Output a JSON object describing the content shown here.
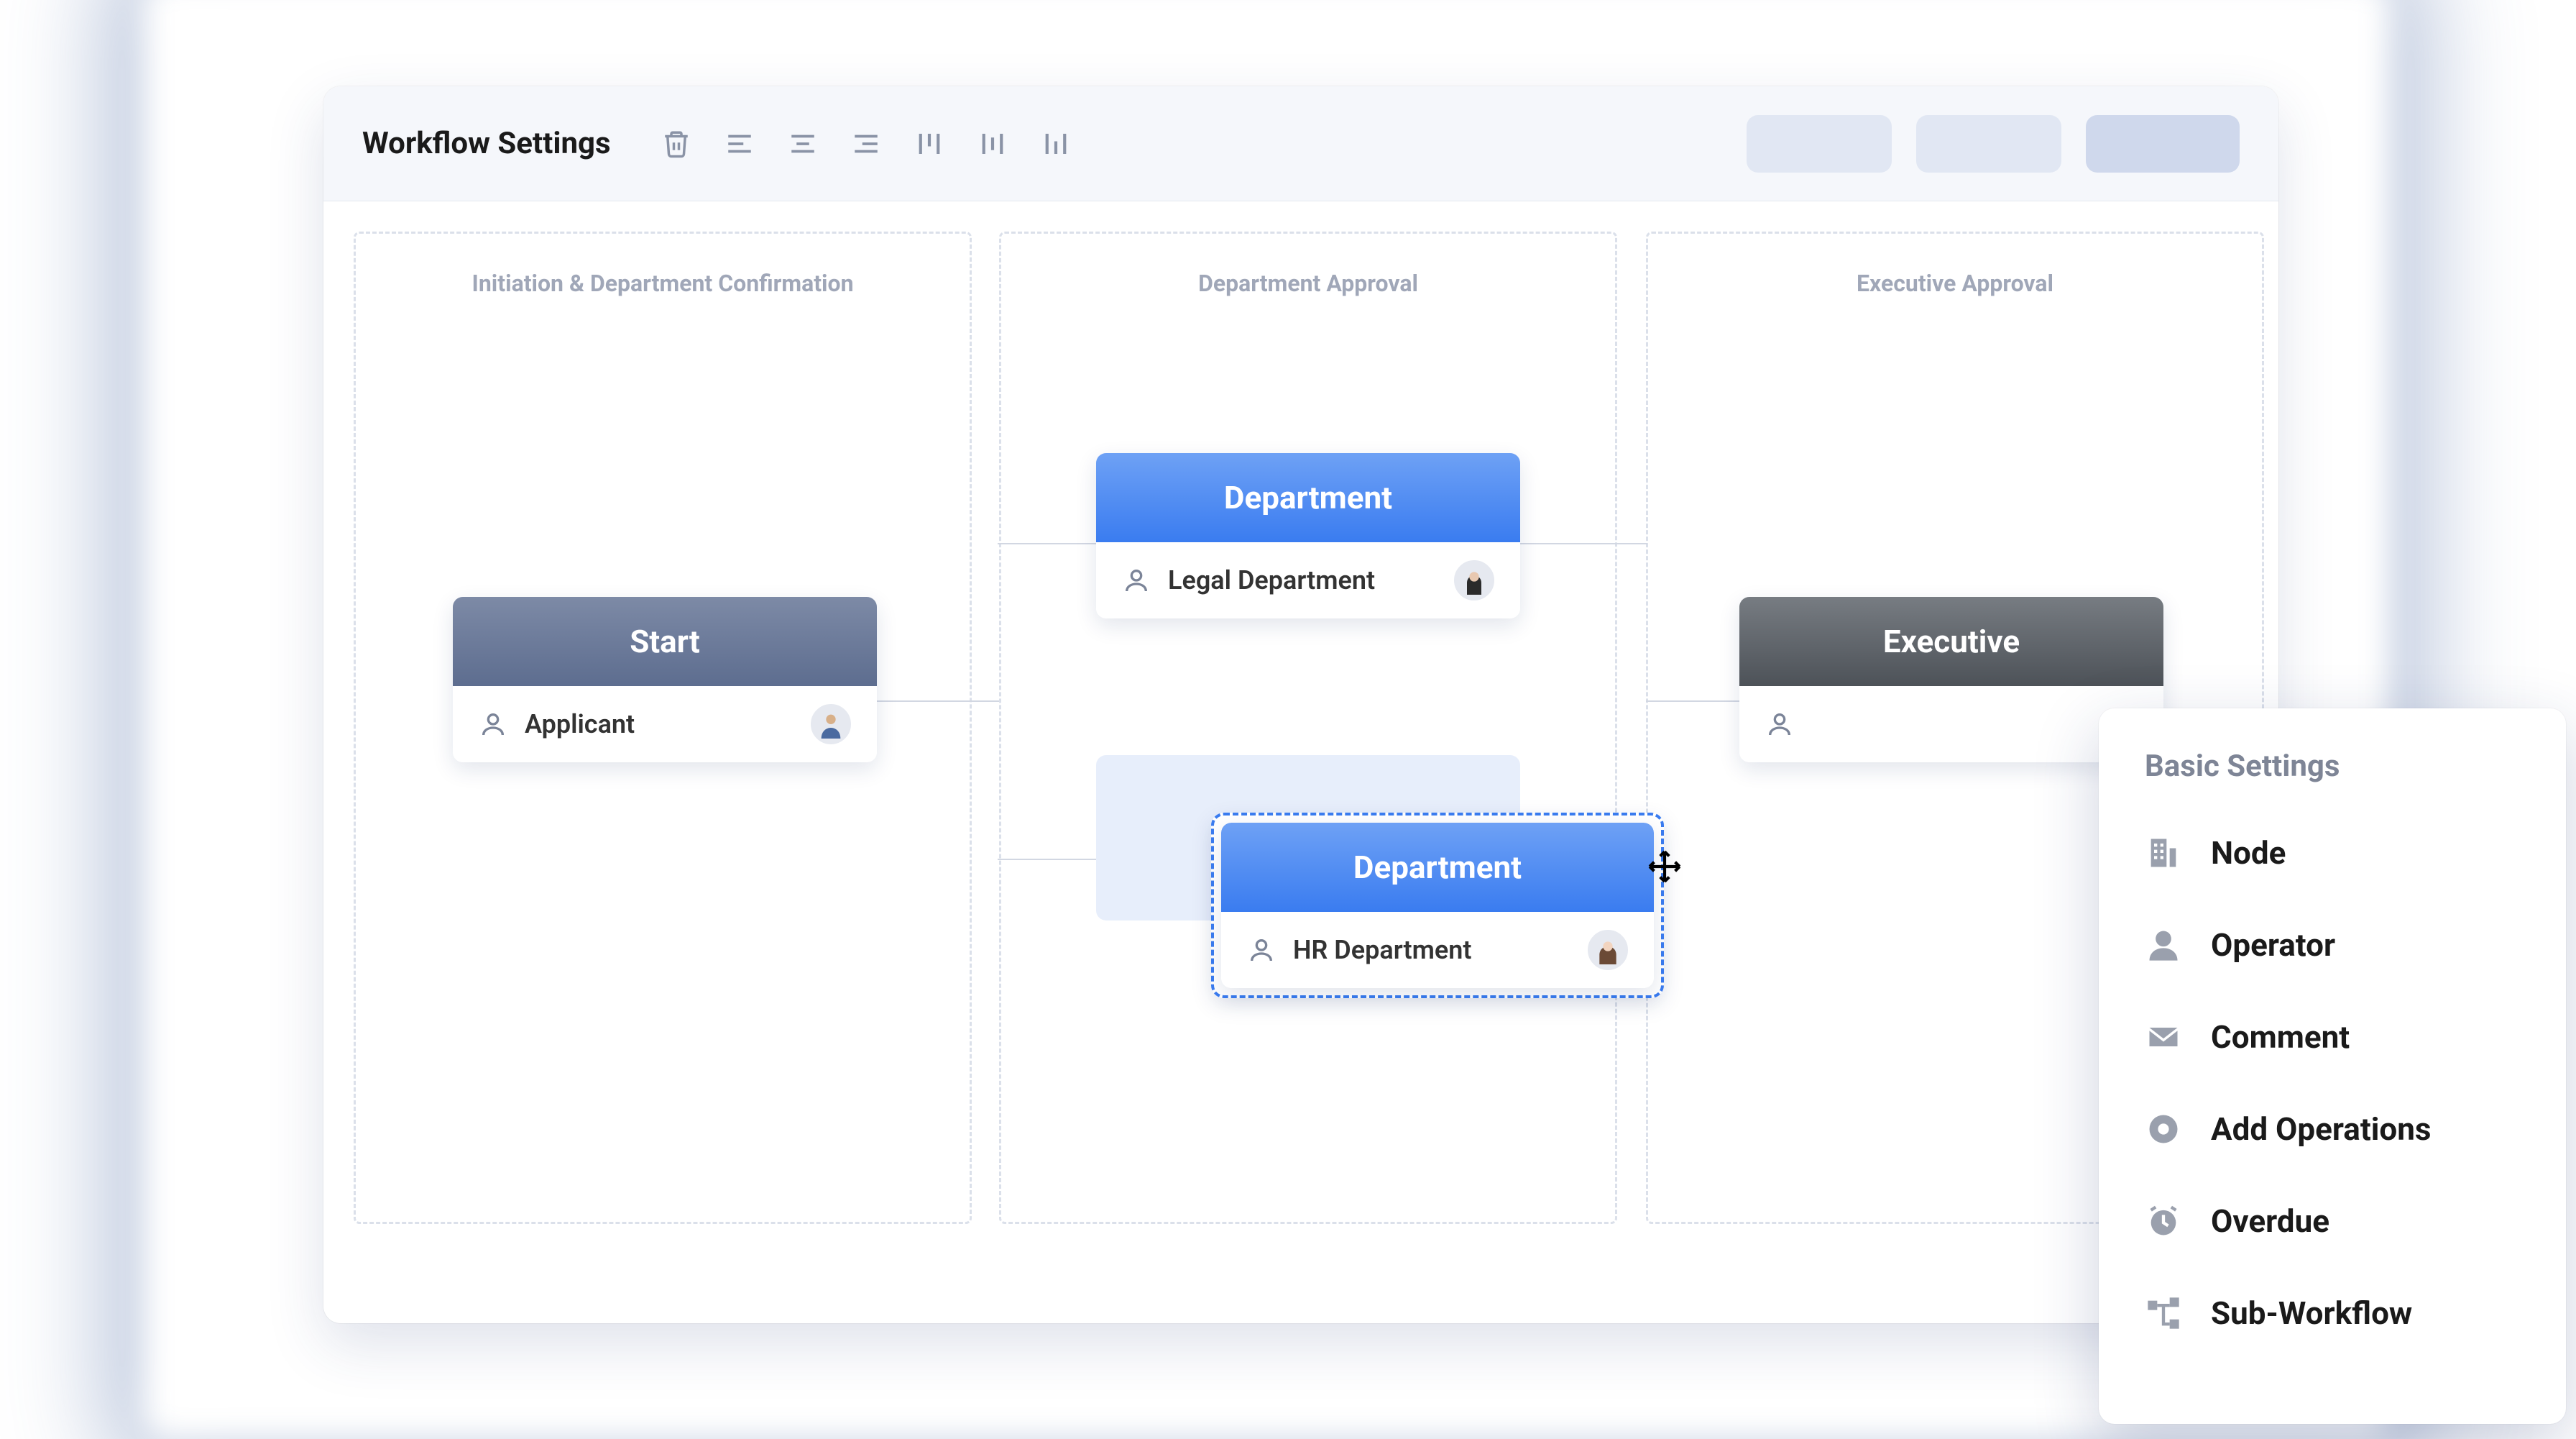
{
  "header": {
    "title": "Workflow Settings"
  },
  "columns": [
    {
      "title": "Initiation & Department Confirmation"
    },
    {
      "title": "Department Approval"
    },
    {
      "title": "Executive Approval"
    }
  ],
  "nodes": {
    "start": {
      "head": "Start",
      "label": "Applicant"
    },
    "dept1": {
      "head": "Department",
      "label": "Legal Department"
    },
    "dept2": {
      "head": "Department",
      "label": "HR Department"
    },
    "exec": {
      "head": "Executive",
      "label": ""
    }
  },
  "popover": {
    "title": "Basic Settings",
    "items": [
      {
        "label": "Node"
      },
      {
        "label": "Operator"
      },
      {
        "label": "Comment"
      },
      {
        "label": "Add Operations"
      },
      {
        "label": "Overdue"
      },
      {
        "label": "Sub-Workflow"
      }
    ]
  }
}
